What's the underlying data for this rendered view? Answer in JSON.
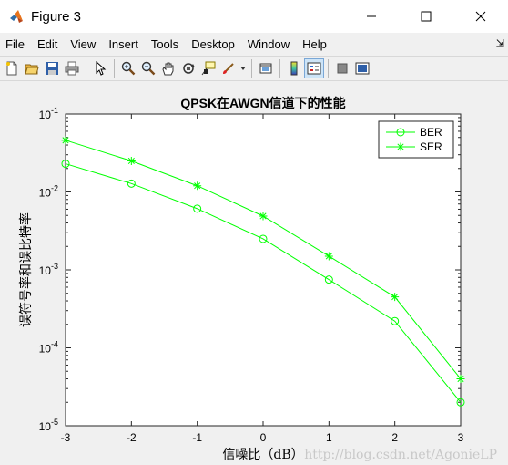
{
  "window": {
    "title": "Figure 3"
  },
  "menu": [
    "File",
    "Edit",
    "View",
    "Insert",
    "Tools",
    "Desktop",
    "Window",
    "Help"
  ],
  "colors": {
    "series": "#00ff00",
    "axes_bg": "#ffffff",
    "figure_bg": "#f0f0f0"
  },
  "toolbar_icons": [
    "new-figure-icon",
    "open-file-icon",
    "save-icon",
    "print-icon",
    "edit-plot-icon",
    "zoom-in-icon",
    "zoom-out-icon",
    "pan-icon",
    "rotate-3d-icon",
    "data-cursor-icon",
    "brush-icon",
    "link-plot-icon",
    "insert-colorbar-icon",
    "insert-legend-icon",
    "hide-plot-tools-icon",
    "show-plot-tools-icon"
  ],
  "chart_data": {
    "type": "line",
    "title": "QPSK在AWGN信道下的性能",
    "xlabel": "信噪比（dB）",
    "ylabel": "误符号率和误比特率",
    "x": [
      -3,
      -2,
      -1,
      0,
      1,
      2,
      3
    ],
    "xlim": [
      -3,
      3
    ],
    "ylim": [
      1e-05,
      0.1
    ],
    "yscale": "log",
    "xticks": [
      "-3",
      "-2",
      "-1",
      "0",
      "1",
      "2",
      "3"
    ],
    "yticks": [
      {
        "base": "10",
        "exp": "-5"
      },
      {
        "base": "10",
        "exp": "-4"
      },
      {
        "base": "10",
        "exp": "-3"
      },
      {
        "base": "10",
        "exp": "-2"
      },
      {
        "base": "10",
        "exp": "-1"
      }
    ],
    "grid": false,
    "legend_position": "top-right",
    "series": [
      {
        "name": "BER",
        "marker": "circle",
        "values": [
          0.023,
          0.0128,
          0.0061,
          0.0025,
          0.00075,
          0.00022,
          2e-05
        ]
      },
      {
        "name": "SER",
        "marker": "star",
        "values": [
          0.046,
          0.025,
          0.012,
          0.0049,
          0.0015,
          0.00045,
          4e-05
        ]
      }
    ]
  },
  "watermark": "http://blog.csdn.net/AgonieLP"
}
